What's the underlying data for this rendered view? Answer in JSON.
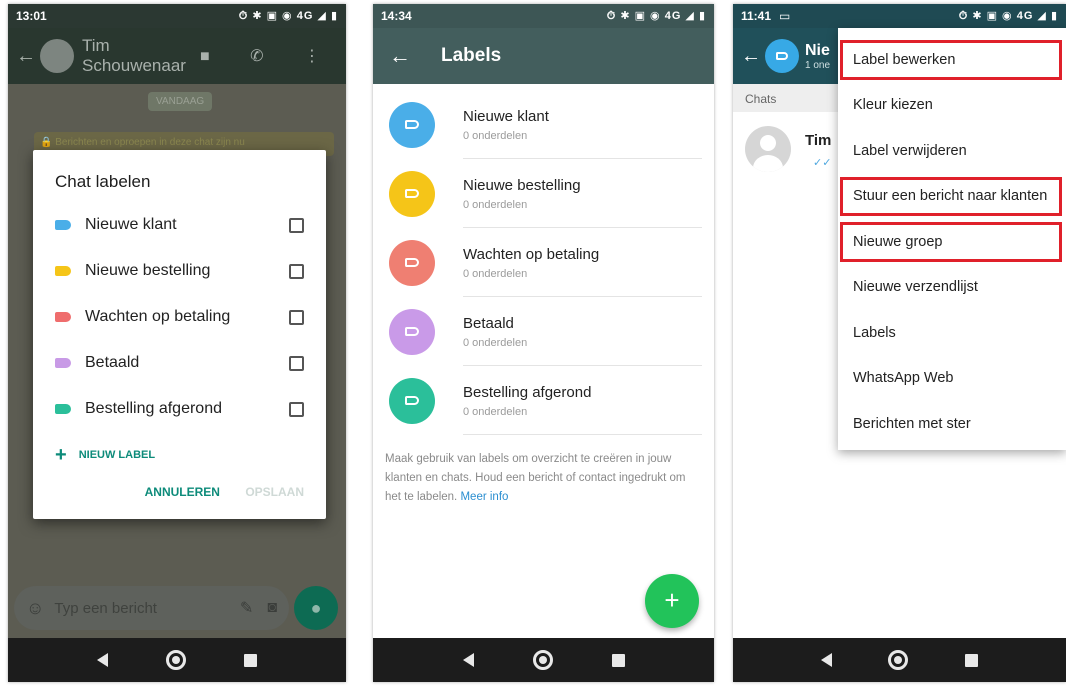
{
  "phone1": {
    "status": {
      "time": "13:01",
      "icons": "⏱ ✱ ▣ ◉ 4G ◢ ▮"
    },
    "header": {
      "contact": "Tim Schouwenaar"
    },
    "date_chip": "VANDAAG",
    "encryption_notice": "🔒 Berichten en oproepen in deze chat zijn nu",
    "dialog": {
      "title": "Chat labelen",
      "labels": [
        {
          "name": "Nieuwe klant",
          "color": "#4aaee8"
        },
        {
          "name": "Nieuwe bestelling",
          "color": "#f5c518"
        },
        {
          "name": "Wachten op betaling",
          "color": "#ef6d6d"
        },
        {
          "name": "Betaald",
          "color": "#c89ae6"
        },
        {
          "name": "Bestelling afgerond",
          "color": "#2bbf9a"
        }
      ],
      "new_label": "NIEUW LABEL",
      "cancel": "ANNULEREN",
      "save": "OPSLAAN"
    },
    "composer_placeholder": "Typ een bericht"
  },
  "phone2": {
    "status": {
      "time": "14:34",
      "icons": "⏱ ✱ ▣ ◉ 4G ◢ ▮"
    },
    "title": "Labels",
    "labels": [
      {
        "name": "Nieuwe klant",
        "count": "0 onderdelen",
        "color": "#4aaee8"
      },
      {
        "name": "Nieuwe bestelling",
        "count": "0 onderdelen",
        "color": "#f5c518"
      },
      {
        "name": "Wachten op betaling",
        "count": "0 onderdelen",
        "color": "#ef7f72"
      },
      {
        "name": "Betaald",
        "count": "0 onderdelen",
        "color": "#c99ae8"
      },
      {
        "name": "Bestelling afgerond",
        "count": "0 onderdelen",
        "color": "#2bbf9a"
      }
    ],
    "info_text": "Maak gebruik van labels om overzicht te creëren in jouw klanten en chats. Houd een bericht of contact ingedrukt om het te labelen.",
    "info_link": "Meer info"
  },
  "phone3": {
    "status": {
      "time": "11:41",
      "icons": "⏱ ✱ ▣ ◉ 4G ◢ ▮"
    },
    "header": {
      "title": "Nie",
      "subtitle": "1 one"
    },
    "chats_header": "Chats",
    "chat_name": "Tim",
    "menu": [
      {
        "label": "Label bewerken",
        "highlighted": true
      },
      {
        "label": "Kleur kiezen",
        "highlighted": false
      },
      {
        "label": "Label verwijderen",
        "highlighted": false
      },
      {
        "label": "Stuur een bericht naar klanten",
        "highlighted": true
      },
      {
        "label": "Nieuwe groep",
        "highlighted": true
      },
      {
        "label": "Nieuwe verzendlijst",
        "highlighted": false
      },
      {
        "label": "Labels",
        "highlighted": false
      },
      {
        "label": "WhatsApp Web",
        "highlighted": false
      },
      {
        "label": "Berichten met ster",
        "highlighted": false
      }
    ]
  },
  "colors": {
    "highlight_border": "#e0202a",
    "fab": "#22c35a",
    "whatsapp_teal": "#0d8b7a"
  }
}
